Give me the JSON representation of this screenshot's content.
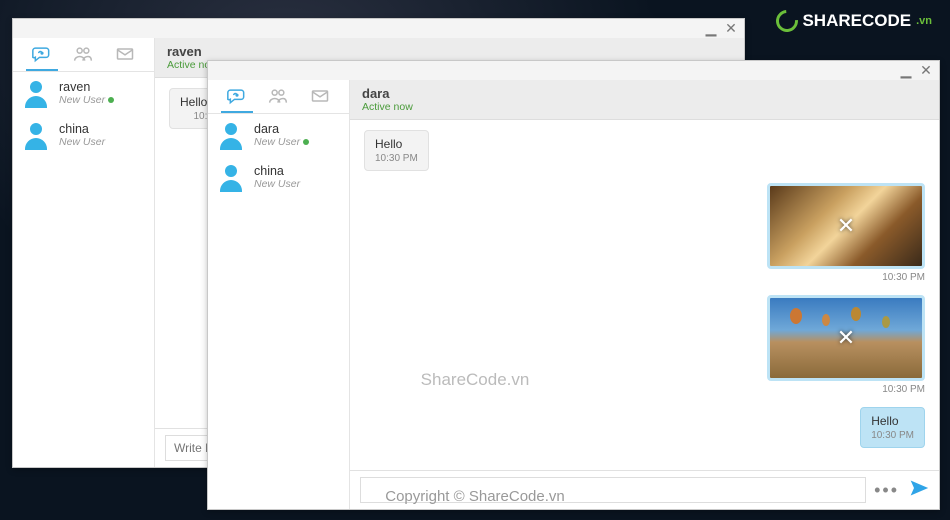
{
  "watermark": {
    "logo_text": "SHARECODE",
    "logo_tld": ".vn",
    "center": "ShareCode.vn",
    "bottom": "Copyright © ShareCode.vn"
  },
  "winA": {
    "header": {
      "name": "raven",
      "status": "Active now"
    },
    "contacts": [
      {
        "name": "raven",
        "sub": "New User",
        "online": true
      },
      {
        "name": "china",
        "sub": "New User",
        "online": false
      }
    ],
    "messages": [
      {
        "dir": "in",
        "text": "Hello",
        "time": "10:"
      }
    ],
    "compose_placeholder": "Write Mess"
  },
  "winB": {
    "header": {
      "name": "dara",
      "status": "Active now"
    },
    "contacts": [
      {
        "name": "dara",
        "sub": "New User",
        "online": true
      },
      {
        "name": "china",
        "sub": "New User",
        "online": false
      }
    ],
    "messages": [
      {
        "dir": "in",
        "text": "Hello",
        "time": "10:30 PM"
      },
      {
        "dir": "out",
        "kind": "image",
        "img": "img1",
        "time": "10:30 PM"
      },
      {
        "dir": "out",
        "kind": "image",
        "img": "img2",
        "time": "10:30 PM"
      },
      {
        "dir": "out",
        "text": "Hello",
        "time": "10:30 PM"
      }
    ],
    "compose_placeholder": ""
  }
}
